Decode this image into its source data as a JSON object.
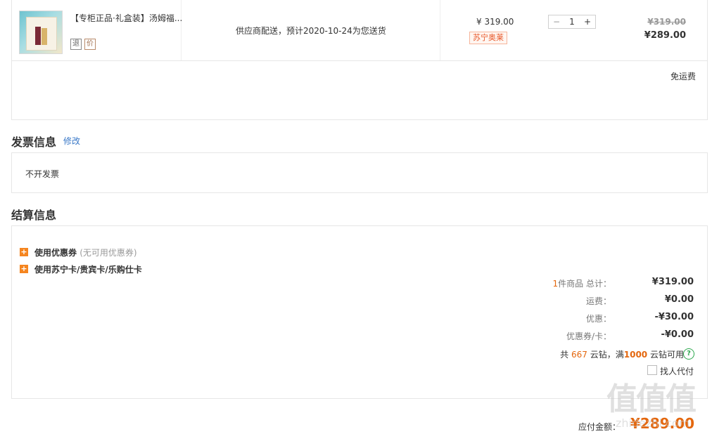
{
  "product": {
    "title": "【专柜正品·礼盒装】汤姆福...",
    "service_icons": [
      "退",
      "价"
    ],
    "delivery": "供应商配送，预计2020-10-24为您送货",
    "unit_price": "¥ 319.00",
    "tag": "苏宁奥莱",
    "quantity": "1",
    "minus_symbol": "−",
    "plus_symbol": "+",
    "original_price": "¥319.00",
    "final_price": "¥289.00",
    "shipping_note": "免运费"
  },
  "invoice": {
    "title": "发票信息",
    "edit_link": "修改",
    "value": "不开发票"
  },
  "settlement": {
    "title": "结算信息",
    "options": [
      {
        "label": "使用优惠券",
        "sub": "(无可用优惠券)"
      },
      {
        "label": "使用苏宁卡/贵宾卡/乐购仕卡",
        "sub": ""
      }
    ],
    "summary": {
      "items_count": "1",
      "items_label": "件商品 总计：",
      "items_total": "¥319.00",
      "shipping_label": "运费：",
      "shipping_value": "¥0.00",
      "discount_label": "优惠：",
      "discount_value": "-¥30.00",
      "coupon_label": "优惠券/卡：",
      "coupon_value": "-¥0.00"
    },
    "diamond": {
      "prefix": "共",
      "count": "667",
      "mid": "云钻，满",
      "threshold": "1000",
      "suffix": "云钻可用"
    },
    "proxy_pay_label": "找人代付",
    "payable_label": "应付金额：",
    "payable_value": "¥289.00"
  },
  "watermark": {
    "logo_text": "值值值",
    "domain": "zhidezhi.com"
  },
  "colors": {
    "accent_orange": "#e4670e",
    "link_blue": "#3a79c8",
    "border": "#e6e6e6"
  }
}
